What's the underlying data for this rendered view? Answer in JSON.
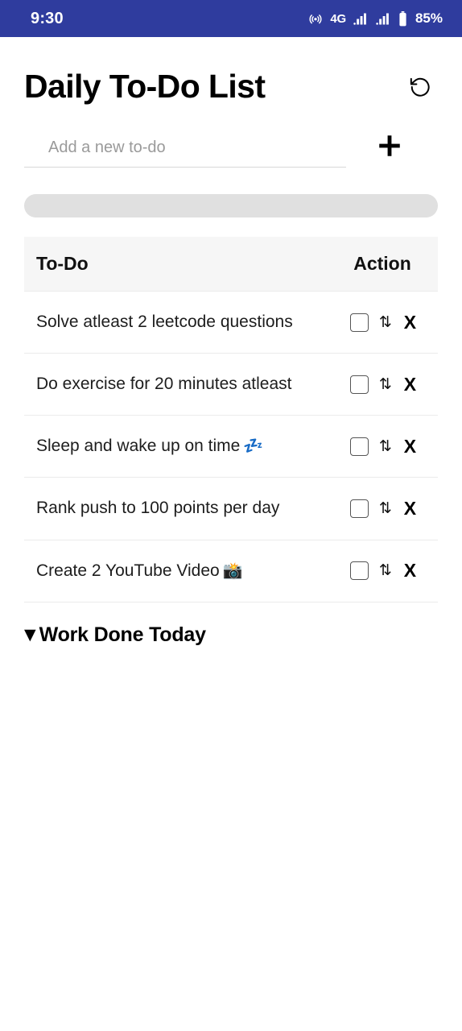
{
  "status_bar": {
    "time": "9:30",
    "network_type": "4G",
    "battery_percent": "85%",
    "hotspot_icon": "hotspot-icon",
    "signal_icon_1": "signal-bars-icon",
    "signal_icon_2": "signal-bars-icon",
    "battery_icon": "battery-icon",
    "background_color": "#2f3c9e"
  },
  "header": {
    "title": "Daily To-Do List",
    "refresh_icon": "refresh-ccw-icon"
  },
  "add_form": {
    "placeholder": "Add a new to-do",
    "value": "",
    "add_icon": "plus-icon"
  },
  "progress": {
    "percent": 0,
    "track_color": "#e0e0e0",
    "fill_color": "#4caf50"
  },
  "table": {
    "columns": [
      "To-Do",
      "Action"
    ],
    "rows": [
      {
        "task": "Solve atleast 2 leetcode questions",
        "emoji": "",
        "checked": false,
        "move_label": "⇅",
        "delete_label": "X"
      },
      {
        "task": "Do exercise for 20 minutes atleast",
        "emoji": "",
        "checked": false,
        "move_label": "⇅",
        "delete_label": "X"
      },
      {
        "task": "Sleep and wake up on time",
        "emoji": "💤",
        "checked": false,
        "move_label": "⇅",
        "delete_label": "X"
      },
      {
        "task": "Rank push to 100 points per day",
        "emoji": "",
        "checked": false,
        "move_label": "⇅",
        "delete_label": "X"
      },
      {
        "task": "Create 2 YouTube Video",
        "emoji": "📸",
        "checked": false,
        "move_label": "⇅",
        "delete_label": "X"
      }
    ]
  },
  "done_section": {
    "caret": "▼",
    "label": "Work Done Today",
    "expanded": true,
    "items": []
  }
}
